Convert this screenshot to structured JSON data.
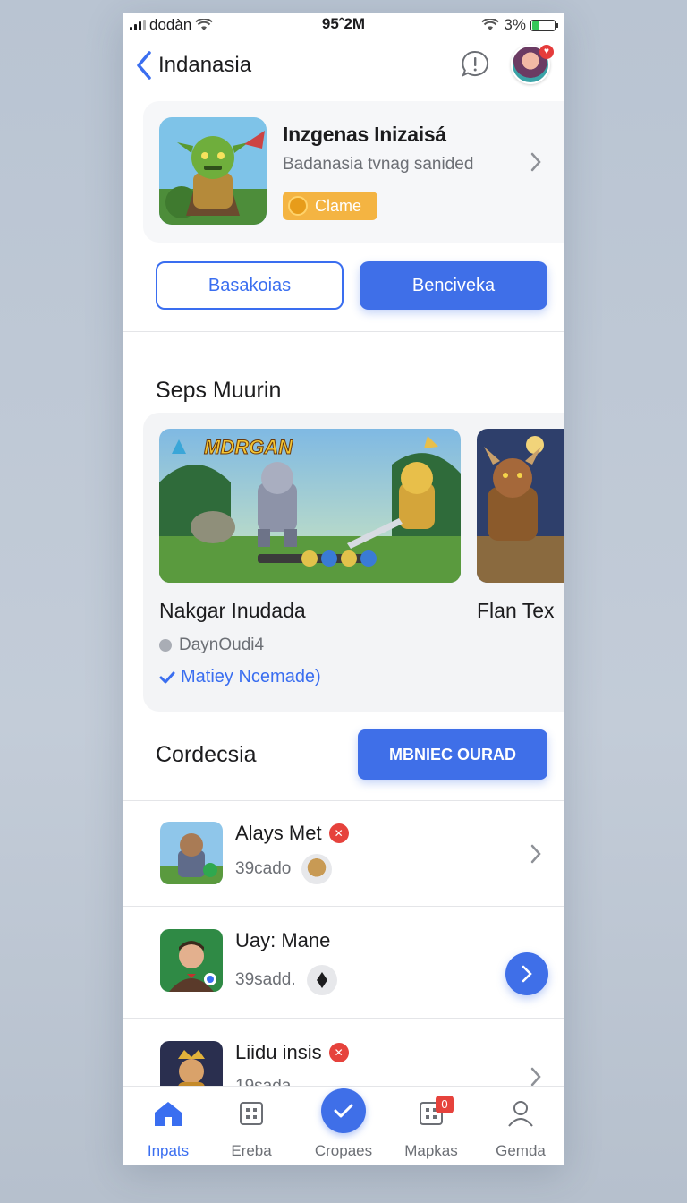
{
  "status": {
    "carrier": "dodàn",
    "time": "95ˆ2M",
    "battery": "3%",
    "battery_level": 0.35
  },
  "nav": {
    "back_title": "Indanasia"
  },
  "featured": {
    "name": "Inzgenas Inizaisá",
    "subtitle": "Badanasia tvnag sanided",
    "pill": "Clame"
  },
  "actions": {
    "outline_label": "Basakoias",
    "solid_label": "Benciveka"
  },
  "section1": {
    "title": "Seps Muurin",
    "games": [
      {
        "name": "Nakgar Inudada",
        "logo": "MDRGAN"
      },
      {
        "name": "Flan Tex"
      }
    ],
    "meta": "DaynOudi4",
    "link": "Matiey Ncemade)"
  },
  "section2": {
    "title": "Cordecsia",
    "button": "MBNIEC OURAD"
  },
  "list": [
    {
      "name": "Alays Met",
      "sub": "39cado",
      "has_badge": true
    },
    {
      "name": "Uay: Mane",
      "sub": "39sadd.",
      "has_badge": false
    },
    {
      "name": "Liidu insis",
      "sub": "19sada",
      "has_badge": true
    }
  ],
  "tabs": [
    {
      "label": "Inpats",
      "icon": "home-icon"
    },
    {
      "label": "Ereba",
      "icon": "grid-icon"
    },
    {
      "label": "Cropaes",
      "icon": "check-icon"
    },
    {
      "label": "Mapkas",
      "icon": "map-grid-icon",
      "badge": "0"
    },
    {
      "label": "Gemda",
      "icon": "person-icon"
    }
  ],
  "colors": {
    "accent": "#3f6fe8",
    "badge": "#e6423c",
    "coin": "#f4b442"
  }
}
